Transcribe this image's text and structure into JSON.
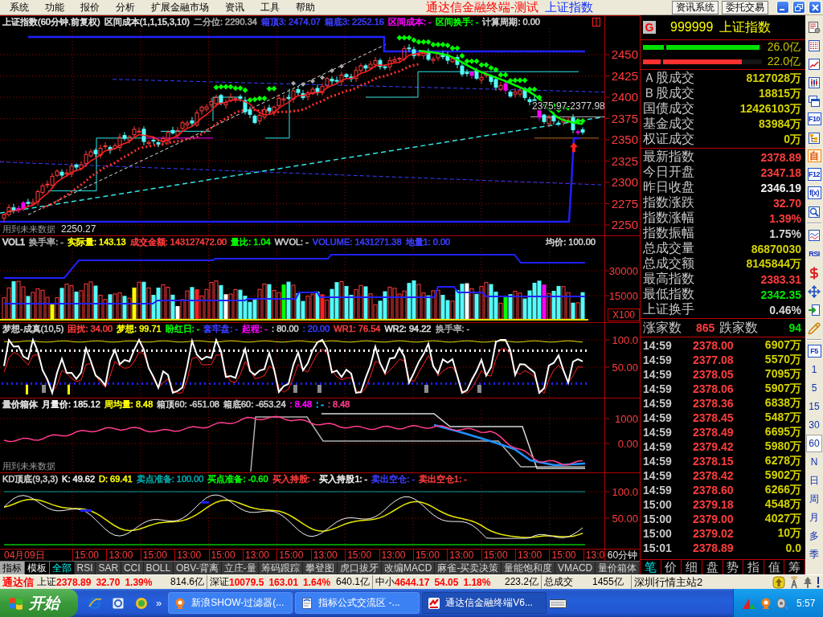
{
  "menu": {
    "items": [
      "系统",
      "功能",
      "报价",
      "分析",
      "扩展金融市场",
      "资讯",
      "工具",
      "帮助"
    ],
    "title": "通达信金融终端-测试",
    "subtitle": "上证指数",
    "buttons": [
      "资讯系统",
      "委托交易"
    ]
  },
  "panels": [
    {
      "kind": "price",
      "header": [
        {
          "text": "上证指数(60分钟.前复权)",
          "color": "#e0e0e0"
        },
        {
          "text": "区间成本(1,1,15,3,10)",
          "color": "#e0e0e0"
        },
        {
          "text": "二分位: 2290.34",
          "color": "#a8a8a8"
        },
        {
          "text": "箱顶3: 2474.07",
          "color": "#3c3cff"
        },
        {
          "text": "箱底3: 2252.16",
          "color": "#3c3cff"
        },
        {
          "text": "区间成本: -",
          "color": "#ff00ff"
        },
        {
          "text": "区间换手: -",
          "color": "#00ff00"
        },
        {
          "text": "计算周期: 0.00",
          "color": "#d0d0d0"
        }
      ],
      "axis": [
        "2450",
        "2425",
        "2400",
        "2375",
        "2350",
        "2325",
        "2300",
        "2275",
        "2250"
      ],
      "notes": {
        "future": "用到未来数据",
        "low": "2250.27",
        "range": "2375.97-2377.98"
      }
    },
    {
      "kind": "volume",
      "header": [
        {
          "text": "VOL1",
          "color": "#d0d0d0"
        },
        {
          "text": "换手率: -",
          "color": "#a8a8a8"
        },
        {
          "text": "实际量: 143.13",
          "color": "#ffff00"
        },
        {
          "text": "成交金额: 143127472.00",
          "color": "#ff3c3c"
        },
        {
          "text": "量比: 1.04",
          "color": "#00ff00"
        },
        {
          "text": "WVOL: -",
          "color": "#d0d0d0"
        },
        {
          "text": "VOLUME: 1431271.38",
          "color": "#3c3cff"
        },
        {
          "text": "地量1: 0.00",
          "color": "#3c3cff"
        }
      ],
      "right_item": {
        "text": "均价: 100.00",
        "color": "#d0d0d0"
      },
      "axis": [
        "30000",
        "15000"
      ],
      "unit": "X100"
    },
    {
      "kind": "dream",
      "header": [
        {
          "text": "梦想-成真(10,5)",
          "color": "#d0d0d0"
        },
        {
          "text": "困扰: 34.00",
          "color": "#ff3c3c"
        },
        {
          "text": "梦想: 99.71",
          "color": "#ffff00"
        },
        {
          "text": "盼红日: -",
          "color": "#00ff00"
        },
        {
          "text": "套牢盘: -",
          "color": "#3c3cff"
        },
        {
          "text": "起程: -",
          "color": "#ff00ff"
        },
        {
          "text": ": 80.00",
          "color": "#d0d0d0"
        },
        {
          "text": ": 20.00",
          "color": "#3c3cff"
        },
        {
          "text": "WR1: 76.54",
          "color": "#ff3c3c"
        },
        {
          "text": "WR2: 94.22",
          "color": "#e0e0e0"
        },
        {
          "text": "换手率: -",
          "color": "#a8a8a8"
        }
      ],
      "axis": [
        "100.0",
        "50.00"
      ]
    },
    {
      "kind": "box",
      "header": [
        {
          "text": "量价箱体",
          "color": "#d0d0d0"
        },
        {
          "text": "月量价: 185.12",
          "color": "#f0f0f0"
        },
        {
          "text": "周均量: 8.48",
          "color": "#ffff00"
        },
        {
          "text": "箱顶60: -651.08",
          "color": "#d0d0d0"
        },
        {
          "text": "箱底60: -653.24",
          "color": "#d0d0d0"
        },
        {
          "text": ": 8.48",
          "color": "#ff00ff"
        },
        {
          "text": ": -",
          "color": "#00c0ff"
        },
        {
          "text": ": 8.48",
          "color": "#ff3c8c"
        }
      ],
      "axis": [
        "1000",
        "0.00"
      ],
      "notes": {
        "future": "用到未来数据"
      }
    },
    {
      "kind": "kd",
      "header": [
        {
          "text": "KD顶底(9,3,3)",
          "color": "#d0d0d0"
        },
        {
          "text": "K: 49.62",
          "color": "#f0f0f0"
        },
        {
          "text": "D: 69.41",
          "color": "#ffff00"
        },
        {
          "text": "卖点准备: 100.00",
          "color": "#00a8a8"
        },
        {
          "text": "买点准备: -0.60",
          "color": "#00ff00"
        },
        {
          "text": "买入持股: -",
          "color": "#ff3c3c"
        },
        {
          "text": "买入持股1: -",
          "color": "#f0f0f0"
        },
        {
          "text": "卖出空仓: -",
          "color": "#3c3cff"
        },
        {
          "text": "卖出空仓1: -",
          "color": "#ff3c3c"
        }
      ],
      "axis": [
        "100.0",
        "50.00"
      ]
    }
  ],
  "time_axis": {
    "labels": [
      "04月09日",
      "15:00",
      "13:00",
      "15:00",
      "13:00",
      "15:00",
      "13:00",
      "15:00",
      "13:00",
      "15:00",
      "13:00",
      "15:00",
      "13:00",
      "15:00",
      "13:00",
      "15:00",
      "13:0"
    ],
    "period": "60分钟"
  },
  "tabs": {
    "mode": [
      {
        "label": "指标",
        "selected": true
      },
      {
        "label": "模板",
        "selected": false
      }
    ],
    "indicators": [
      {
        "label": "全部",
        "selected": true
      },
      {
        "label": "RSI",
        "selected": false
      },
      {
        "label": "SAR",
        "selected": false
      },
      {
        "label": "CCI",
        "selected": false
      },
      {
        "label": "BOLL",
        "selected": false
      },
      {
        "label": "OBV-背离",
        "selected": false
      },
      {
        "label": "立庄-量",
        "selected": false
      },
      {
        "label": "筹码跟踪",
        "selected": false
      },
      {
        "label": "攀登图",
        "selected": false
      },
      {
        "label": "虎口拔牙",
        "selected": false
      },
      {
        "label": "改编MACD",
        "selected": false
      },
      {
        "label": "麻雀-买卖决策",
        "selected": false
      },
      {
        "label": "量能饱和度",
        "selected": false
      },
      {
        "label": "VMACD",
        "selected": false
      },
      {
        "label": "量价箱体",
        "selected": false
      }
    ]
  },
  "quote": {
    "badge": "G",
    "code": "999999",
    "name": "上证指数",
    "flow_bars": [
      {
        "value": "26.0亿",
        "level": 0.98,
        "color": "#00e000"
      },
      {
        "value": "22.0亿",
        "level": 0.83,
        "color": "#ff3030"
      }
    ],
    "turnover": [
      {
        "label": "Ａ股成交",
        "value": "8127028万"
      },
      {
        "label": "Ｂ股成交",
        "value": "18815万"
      },
      {
        "label": "国债成交",
        "value": "12426103万"
      },
      {
        "label": "基金成交",
        "value": "83984万"
      },
      {
        "label": "权证成交",
        "value": "0万"
      }
    ],
    "stats": [
      {
        "label": "最新指数",
        "value": "2378.89",
        "color": "#ff3c3c"
      },
      {
        "label": "今日开盘",
        "value": "2347.18",
        "color": "#ff3c3c"
      },
      {
        "label": "昨日收盘",
        "value": "2346.19",
        "color": "#f0f0f0"
      },
      {
        "label": "指数涨跌",
        "value": "32.70",
        "color": "#ff3c3c"
      },
      {
        "label": "指数涨幅",
        "value": "1.39%",
        "color": "#ff3c3c"
      },
      {
        "label": "指数振幅",
        "value": "1.75%",
        "color": "#d8d8d8"
      },
      {
        "label": "总成交量",
        "value": "86870030",
        "color": "#d4d400"
      },
      {
        "label": "总成交额",
        "value": "8145844万",
        "color": "#d4d400"
      },
      {
        "label": "最高指数",
        "value": "2383.31",
        "color": "#ff3c3c"
      },
      {
        "label": "最低指数",
        "value": "2342.35",
        "color": "#00e600"
      },
      {
        "label": "上证换手",
        "value": "0.46%",
        "color": "#d8d8d8"
      }
    ],
    "breadth": {
      "up_label": "涨家数",
      "up": "865",
      "down_label": "跌家数",
      "down": "94"
    },
    "ticks": [
      {
        "time": "14:59",
        "price": "2378.00",
        "volume": "6907万"
      },
      {
        "time": "14:59",
        "price": "2377.08",
        "volume": "5570万"
      },
      {
        "time": "14:59",
        "price": "2378.05",
        "volume": "7095万"
      },
      {
        "time": "14:59",
        "price": "2378.06",
        "volume": "5907万"
      },
      {
        "time": "14:59",
        "price": "2378.36",
        "volume": "6838万"
      },
      {
        "time": "14:59",
        "price": "2378.45",
        "volume": "5487万"
      },
      {
        "time": "14:59",
        "price": "2378.49",
        "volume": "6695万"
      },
      {
        "time": "14:59",
        "price": "2379.42",
        "volume": "5980万"
      },
      {
        "time": "14:59",
        "price": "2378.15",
        "volume": "6278万"
      },
      {
        "time": "14:59",
        "price": "2378.42",
        "volume": "5902万"
      },
      {
        "time": "14:59",
        "price": "2378.60",
        "volume": "6266万"
      },
      {
        "time": "15:00",
        "price": "2379.18",
        "volume": "4548万"
      },
      {
        "time": "15:00",
        "price": "2379.00",
        "volume": "4027万"
      },
      {
        "time": "15:00",
        "price": "2379.02",
        "volume": "10万"
      },
      {
        "time": "15:01",
        "price": "2378.89",
        "volume": "0.0"
      }
    ],
    "tabs": [
      {
        "label": "笔",
        "selected": true
      },
      {
        "label": "价",
        "selected": false
      },
      {
        "label": "细",
        "selected": false
      },
      {
        "label": "盘",
        "selected": false
      },
      {
        "label": "势",
        "selected": false
      },
      {
        "label": "指",
        "selected": false
      },
      {
        "label": "值",
        "selected": false
      },
      {
        "label": "筹",
        "selected": false
      }
    ]
  },
  "toolbar": {
    "labels": [
      {
        "label": "F10",
        "kind": "boxed"
      },
      {
        "label": "自",
        "kind": "tile"
      },
      {
        "label": "F12",
        "kind": "boxed"
      },
      {
        "label": "f(x)",
        "kind": "boxed"
      },
      {
        "label": "RSI",
        "kind": "plain"
      },
      {
        "label": "F5",
        "kind": "boxed"
      }
    ],
    "periods": [
      {
        "label": "1",
        "selected": false
      },
      {
        "label": "5",
        "selected": false
      },
      {
        "label": "15",
        "selected": false
      },
      {
        "label": "30",
        "selected": false
      },
      {
        "label": "60",
        "selected": true
      },
      {
        "label": "N",
        "selected": false
      },
      {
        "label": "日",
        "selected": false
      },
      {
        "label": "周",
        "selected": false
      },
      {
        "label": "月",
        "selected": false
      },
      {
        "label": "多",
        "selected": false
      },
      {
        "label": "季",
        "selected": false
      }
    ]
  },
  "status_bar": {
    "brand": "通达信",
    "markets": [
      {
        "name": "上证",
        "value": "2378.89",
        "change": "32.70",
        "percent": "1.39%",
        "amount": "814.6亿",
        "color": "#ff0000"
      },
      {
        "name": "深证",
        "value": "10079.5",
        "change": "163.01",
        "percent": "1.64%",
        "amount": "640.1亿",
        "color": "#ff0000"
      },
      {
        "name": "中小",
        "value": "4644.17",
        "change": "54.05",
        "percent": "1.18%",
        "amount": "223.2亿",
        "color": "#ff0000"
      }
    ],
    "total_label": "总成交",
    "total": "1455亿",
    "server": "深圳行情主站2"
  },
  "taskbar": {
    "start": "开始",
    "chevron": "»",
    "tasks": [
      {
        "label": "新浪SHOW-过滤器(...",
        "selected": false
      },
      {
        "label": "指标公式交流区 -...",
        "selected": false
      },
      {
        "label": "通达信金融终端V6...",
        "selected": true
      }
    ],
    "clock": "5:57"
  }
}
